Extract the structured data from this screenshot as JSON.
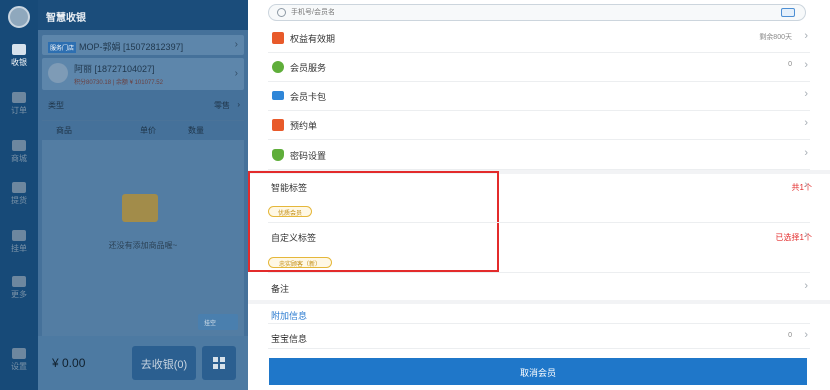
{
  "app": {
    "title": "智慧收银"
  },
  "rail": {
    "items": [
      {
        "label": "收银",
        "active": true
      },
      {
        "label": "订单",
        "active": false
      },
      {
        "label": "商城",
        "active": false
      },
      {
        "label": "提货",
        "active": false
      },
      {
        "label": "挂单",
        "active": false
      },
      {
        "label": "更多",
        "active": false
      },
      {
        "label": "设置",
        "active": false
      }
    ]
  },
  "pos": {
    "store": {
      "tag": "服务门店",
      "text": "MOP-郭娟 [15072812397]"
    },
    "member": {
      "name": "阿丽 [18727104027]",
      "sub": "积分80730.18 | 余额 ¥ 101077.52"
    },
    "type_label": "类型",
    "type_value": "零售",
    "columns": [
      "商品",
      "单价",
      "数量"
    ],
    "empty_text": "还没有添加商品喔~",
    "guadan_label": "挂空",
    "total": "¥ 0.00",
    "checkout_label": "去收银(0)"
  },
  "panel": {
    "search_placeholder": "手机号/会员名",
    "rows": [
      {
        "label": "权益有效期",
        "value": "剩余800天",
        "icon": "gift-icon",
        "color": "#e85a2a"
      },
      {
        "label": "会员服务",
        "value": "0",
        "icon": "member-service-icon",
        "color": "#5fae3a"
      },
      {
        "label": "会员卡包",
        "value": "",
        "icon": "card-wallet-icon",
        "color": "#2f86d8"
      },
      {
        "label": "预约单",
        "value": "",
        "icon": "calendar-icon",
        "color": "#e85a2a"
      },
      {
        "label": "密码设置",
        "value": "",
        "icon": "shield-icon",
        "color": "#5fae3a"
      }
    ],
    "smart_tags": {
      "label": "智能标签",
      "count": "共1个",
      "pill": "优质会员"
    },
    "custom_tags": {
      "label": "自定义标签",
      "count": "已选择1个",
      "pill": "忠实顾客（新）"
    },
    "remark_label": "备注",
    "extra_section": "附加信息",
    "baby_label": "宝宝信息",
    "baby_value": "0",
    "cancel_label": "取消会员"
  }
}
